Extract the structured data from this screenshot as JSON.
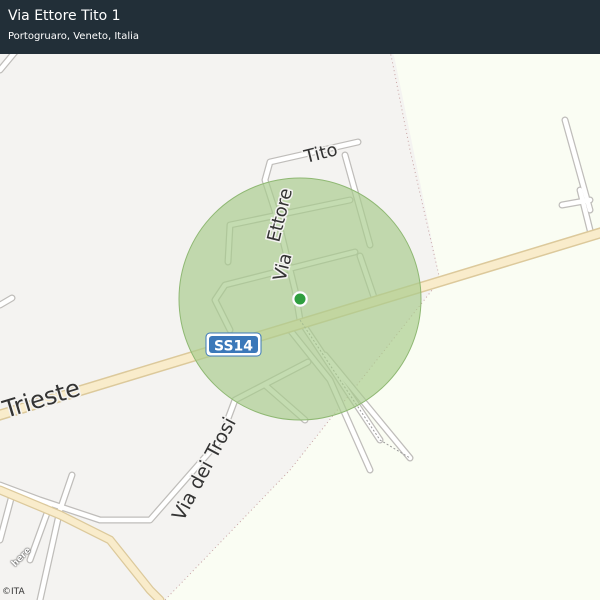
{
  "header": {
    "title": "Via Ettore Tito 1",
    "subtitle": "Portogruaro, Veneto, Italia"
  },
  "map": {
    "labels": {
      "via_ettore": "Via",
      "via_ettore_name": "Ettore",
      "tito": "Tito",
      "trieste": "Trieste",
      "via_dei_trosi": "Via dei Trosi",
      "ss14": "SS14"
    },
    "colors": {
      "land": "#f4f3f1",
      "field": "#fafdf3",
      "road_fill": "#ffffff",
      "road_casing": "#bfbdba",
      "main_road_fill": "#f9eccb",
      "main_road_casing": "#dcc99b",
      "accuracy_circle": "#a8cc8c",
      "location_dot": "#2f9e3f",
      "shield_bg": "#3b78b9",
      "header_bg": "#222f38"
    },
    "attribution": {
      "logo": "here",
      "copyright": "©ITA"
    }
  }
}
